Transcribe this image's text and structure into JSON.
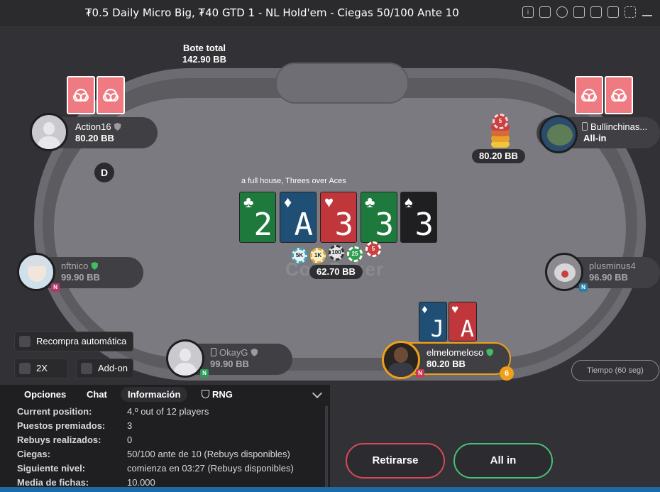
{
  "window": {
    "title": "₮0.5 Daily Micro Big, ₮40 GTD 1 - NL Hold'em - Ciegas 50/100 Ante 10"
  },
  "pot": {
    "label": "Bote total",
    "value": "142.90 BB"
  },
  "board": {
    "description": "a full house, Threes over Aces",
    "cards": [
      {
        "rank": "2",
        "suit": "♣",
        "color": "green"
      },
      {
        "rank": "A",
        "suit": "♦",
        "color": "blue"
      },
      {
        "rank": "3",
        "suit": "♥",
        "color": "red"
      },
      {
        "rank": "3",
        "suit": "♣",
        "color": "green"
      },
      {
        "rank": "3",
        "suit": "♠",
        "color": "black"
      }
    ],
    "chip_labels": [
      "5K",
      "1K",
      "100",
      "25",
      "5"
    ],
    "center_bet": "62.70 BB"
  },
  "watermark": "CoinPoker",
  "players": {
    "action16": {
      "name": "Action16",
      "stack": "80.20 BB"
    },
    "bullinchinas": {
      "name": "Bullinchinas...",
      "stack": "All-in",
      "bet": "80.20 BB",
      "chip_top": "5"
    },
    "nftnico": {
      "name": "nftnico",
      "stack": "99.90 BB",
      "badge": "N"
    },
    "plusminus4": {
      "name": "plusminus4",
      "stack": "96.90 BB",
      "badge": "N"
    },
    "okayg": {
      "name": "OkayG",
      "stack": "99.90 BB",
      "badge": "N"
    },
    "hero": {
      "name": "elmelomeloso",
      "stack": "80.20 BB",
      "badge": "N",
      "seat_badge": "6",
      "cards": [
        {
          "rank": "J",
          "suit": "♦",
          "color": "blue"
        },
        {
          "rank": "A",
          "suit": "♥",
          "color": "red"
        }
      ]
    }
  },
  "dealer_button": "D",
  "timer": "Tiempo (60 seg)",
  "options": {
    "auto_rebuy": "Recompra automática",
    "two_x": "2X",
    "add_on": "Add-on"
  },
  "tabs": [
    "Opciones",
    "Chat",
    "Información",
    "RNG"
  ],
  "info": [
    {
      "key": "Current position:",
      "value": "4.º out of 12 players"
    },
    {
      "key": "Puestos premiados:",
      "value": "3"
    },
    {
      "key": "Rebuys realizados:",
      "value": "0"
    },
    {
      "key": "Ciegas:",
      "value": "50/100 ante de 10 (Rebuys disponibles)"
    },
    {
      "key": "Siguiente nivel:",
      "value": "comienza en 03:27 (Rebuys disponibles)"
    },
    {
      "key": "Media de fichas:",
      "value": "10.000"
    }
  ],
  "actions": {
    "fold": "Retirarse",
    "allin": "All in"
  },
  "colors": {
    "card_green": "#1e7a3c",
    "card_blue": "#1f4f75",
    "card_red": "#c1363a",
    "card_black": "#1f1f22",
    "fold_border": "#d9485a",
    "allin_border": "#47c07a",
    "hero_border": "#f0a018"
  },
  "icons": [
    "info-icon",
    "cashier-icon",
    "history-icon",
    "lobby-icon",
    "tables-icon",
    "settings-icon",
    "resize-icon",
    "minimize-icon"
  ]
}
